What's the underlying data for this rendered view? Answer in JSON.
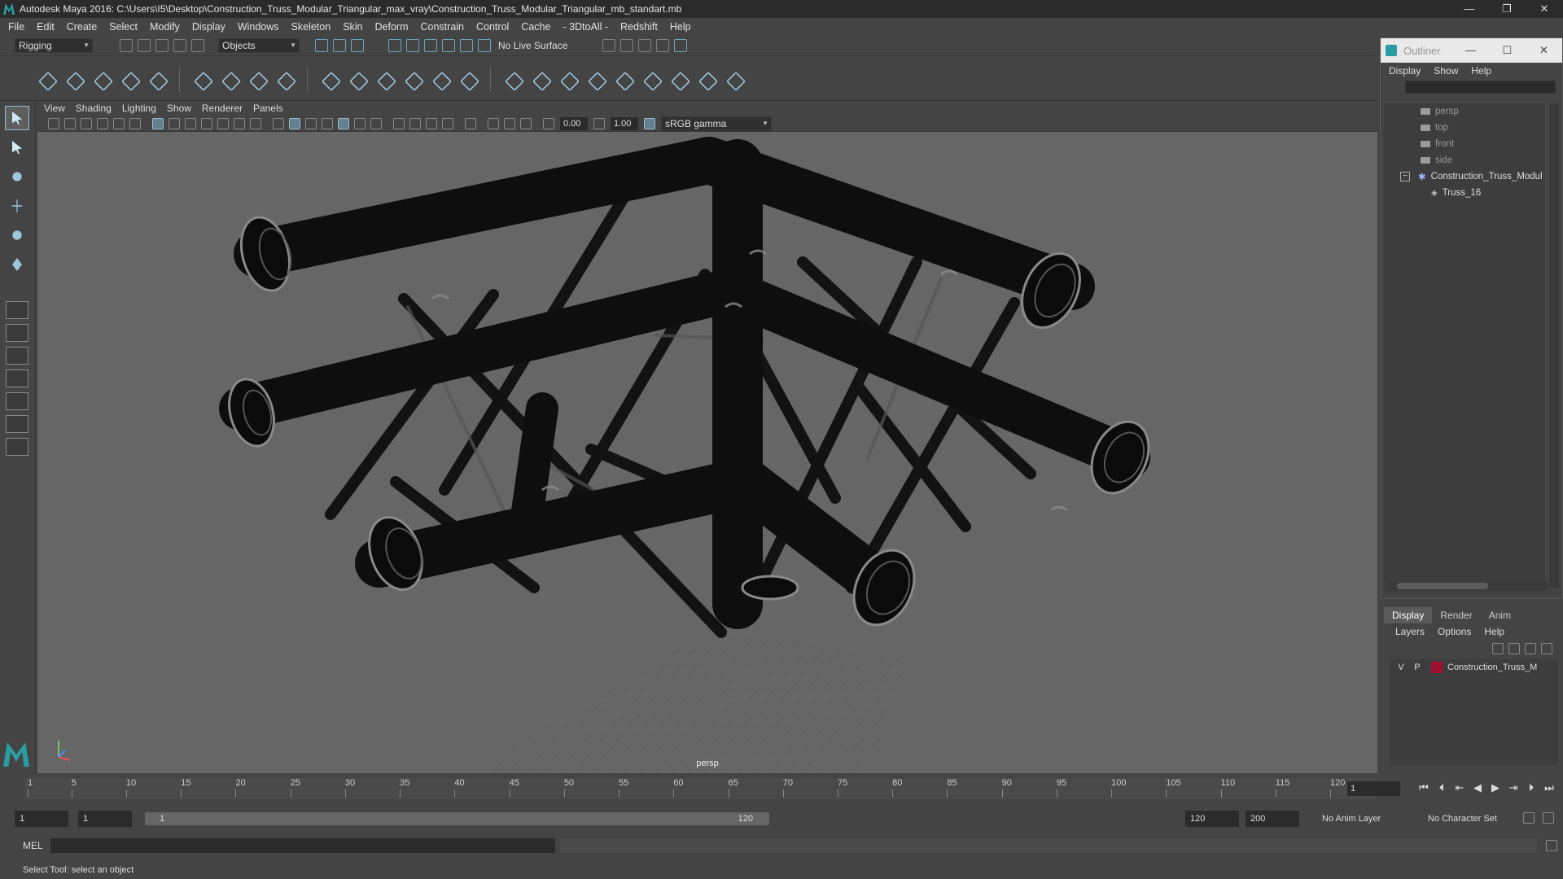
{
  "window": {
    "title": "Autodesk Maya 2016: C:\\Users\\I5\\Desktop\\Construction_Truss_Modular_Triangular_max_vray\\Construction_Truss_Modular_Triangular_mb_standart.mb",
    "minimize": "—",
    "maximize": "❐",
    "close": "✕"
  },
  "menubar": [
    "File",
    "Edit",
    "Create",
    "Select",
    "Modify",
    "Display",
    "Windows",
    "Skeleton",
    "Skin",
    "Deform",
    "Constrain",
    "Control",
    "Cache",
    "- 3DtoAll -",
    "Redshift",
    "Help"
  ],
  "statusline": {
    "mode": "Rigging",
    "selection_mask": "Objects",
    "live_surface": "No Live Surface"
  },
  "viewport": {
    "menu": [
      "View",
      "Shading",
      "Lighting",
      "Show",
      "Renderer",
      "Panels"
    ],
    "exposure": "0.00",
    "gamma": "1.00",
    "color_space": "sRGB gamma",
    "camera": "persp"
  },
  "outliner": {
    "title": "Outliner",
    "menu": [
      "Display",
      "Show",
      "Help"
    ],
    "items": [
      {
        "label": "persp",
        "type": "camera"
      },
      {
        "label": "top",
        "type": "camera"
      },
      {
        "label": "front",
        "type": "camera"
      },
      {
        "label": "side",
        "type": "camera"
      },
      {
        "label": "Construction_Truss_Modul",
        "type": "group"
      },
      {
        "label": "Truss_16",
        "type": "mesh"
      }
    ],
    "collapse_icon": "minus-box-icon"
  },
  "layers": {
    "tabs": [
      "Display",
      "Render",
      "Anim"
    ],
    "menu": [
      "Layers",
      "Options",
      "Help"
    ],
    "row": {
      "v": "V",
      "p": "P",
      "name": "Construction_Truss_M",
      "color": "#a01030"
    }
  },
  "timeline": {
    "ticks": [
      "1",
      "5",
      "10",
      "15",
      "20",
      "25",
      "30",
      "35",
      "40",
      "45",
      "50",
      "55",
      "60",
      "65",
      "70",
      "75",
      "80",
      "85",
      "90",
      "95",
      "100",
      "105",
      "110",
      "115",
      "120"
    ],
    "current_frame": "1"
  },
  "range": {
    "start": "1",
    "playback_start": "1",
    "bar_start": "1",
    "bar_end": "120",
    "playback_end": "120",
    "end": "200",
    "anim_layer": "No Anim Layer",
    "character_set": "No Character Set"
  },
  "mel": {
    "label": "MEL"
  },
  "status": {
    "help": "Select Tool: select an object"
  }
}
